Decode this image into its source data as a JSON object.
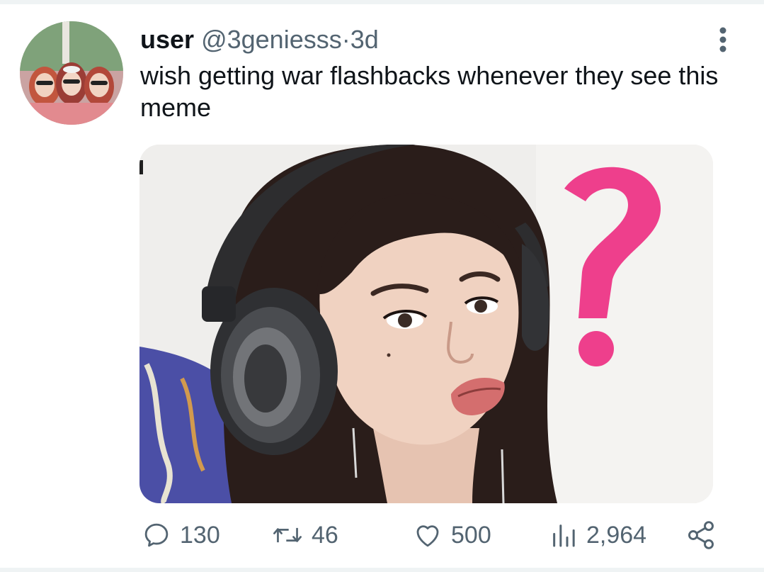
{
  "tweet": {
    "display_name": "user",
    "handle": "@3geniesss",
    "separator": "·",
    "time": "3d",
    "text": "wish getting war flashbacks whenever they see this meme"
  },
  "actions": {
    "replies": "130",
    "retweets": "46",
    "likes": "500",
    "views": "2,964"
  },
  "icons": {
    "more": "more-vertical-icon",
    "reply": "reply-icon",
    "retweet": "retweet-icon",
    "like": "heart-icon",
    "views": "views-chart-icon",
    "share": "share-icon"
  },
  "colors": {
    "text": "#0f1419",
    "secondary": "#536471",
    "divider": "#eff3f4",
    "question_mark": "#ee3f8c"
  }
}
